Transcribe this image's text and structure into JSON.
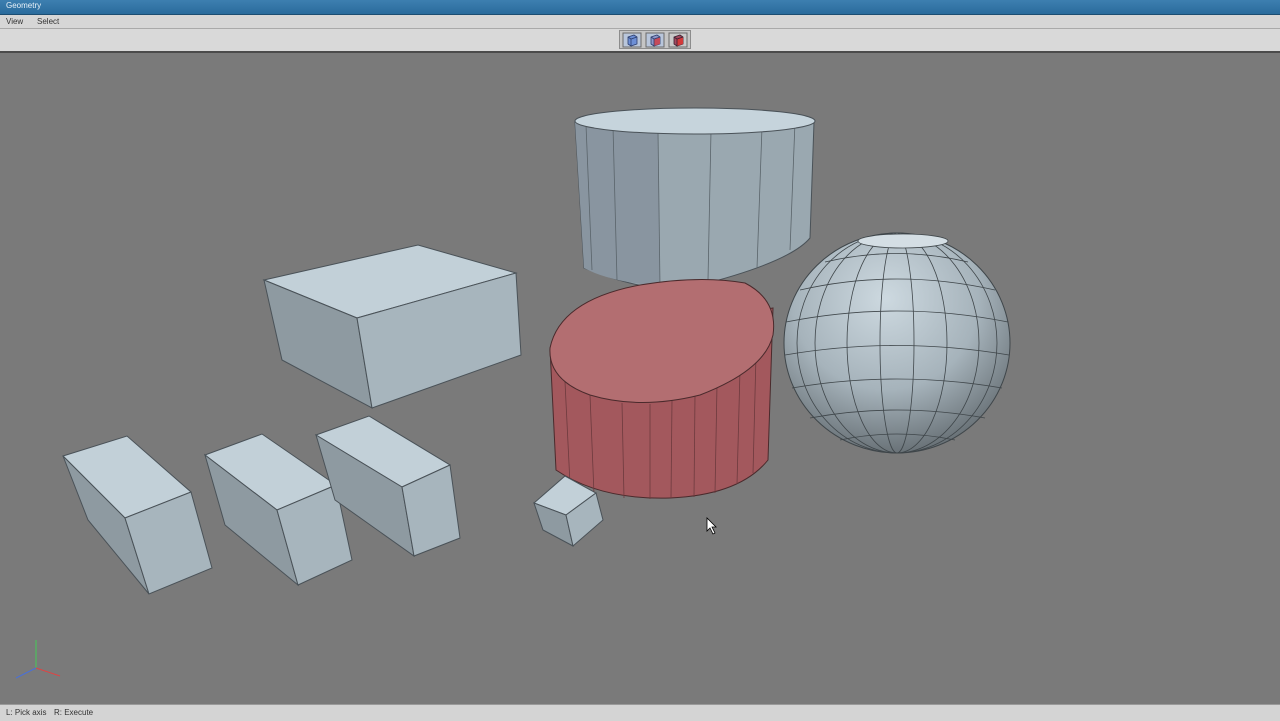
{
  "window": {
    "title": "Geometry"
  },
  "menu": {
    "items": [
      "View",
      "Select"
    ]
  },
  "toolbar": {
    "buttons": [
      {
        "icon": "cube-select-icon",
        "color": "#6d8fd6"
      },
      {
        "icon": "cube-face-select-icon",
        "color": "#c54a5a"
      },
      {
        "icon": "cube-object-select-icon",
        "color": "#d33a3a"
      }
    ]
  },
  "viewport": {
    "objects": [
      "large-box",
      "tall-cylinder",
      "selected-cylinder",
      "sphere",
      "small-cube",
      "box-left",
      "box-middle",
      "box-right"
    ],
    "selection_color": "#b76d70",
    "object_color": "#a9b9c3"
  },
  "status": {
    "left_hint": "L: Pick axis",
    "right_hint": "R: Execute"
  }
}
